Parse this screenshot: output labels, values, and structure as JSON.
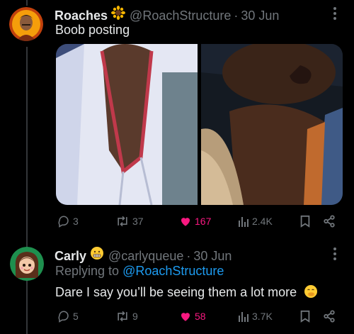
{
  "post": {
    "display_name": "Roaches",
    "handle": "@RoachStructure",
    "separator": "·",
    "date": "30 Jun",
    "text": "Boob posting",
    "stats": {
      "replies": "3",
      "reposts": "37",
      "likes": "167",
      "views": "2.4K"
    }
  },
  "reply": {
    "display_name": "Carly",
    "handle": "@carlyqueue",
    "separator": "·",
    "date": "30 Jun",
    "replying_prefix": "Replying to",
    "replying_handle": "@RoachStructure",
    "text": "Dare I say you’ll be seeing them a lot more",
    "stats": {
      "replies": "5",
      "reposts": "9",
      "likes": "58",
      "views": "3.7K"
    }
  },
  "colors": {
    "like_active": "#f91880",
    "link": "#1d9bf0",
    "muted": "#71767b"
  }
}
